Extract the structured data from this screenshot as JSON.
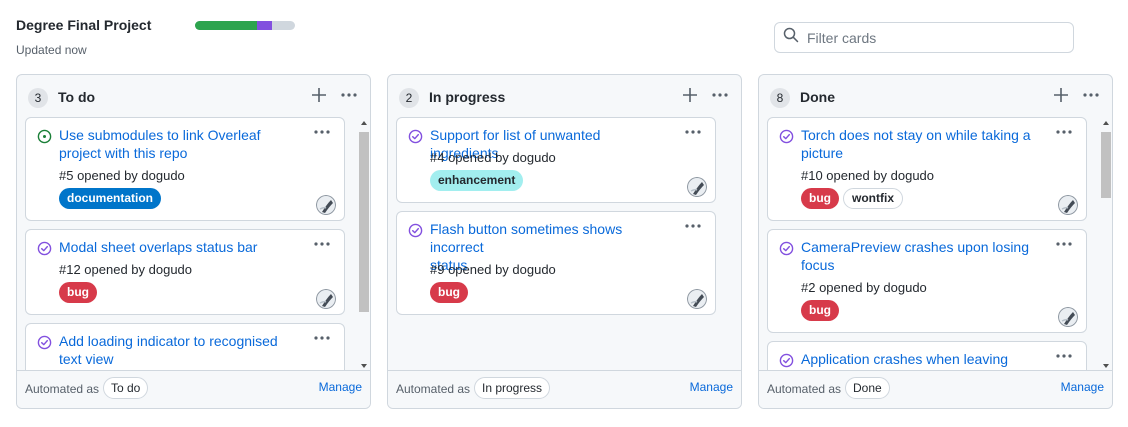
{
  "project": {
    "title": "Degree Final Project",
    "updated": "Updated now",
    "progress": {
      "done_percent": 62,
      "in_progress_percent": 15,
      "todo_percent": 23
    },
    "colors": {
      "done": "#2da44e",
      "in_progress": "#8250df",
      "todo": "#d0d7de"
    }
  },
  "filter": {
    "placeholder": "Filter cards",
    "value": "",
    "icon": "search-icon"
  },
  "columns": [
    {
      "count": "3",
      "title": "To do",
      "automated_prefix": "Automated as",
      "automated_value": "To do",
      "manage": "Manage",
      "cards": [
        {
          "title_line1": "Use submodules to link Overleaf",
          "title_line2": "project with this repo",
          "meta": "#5 opened by dogudo",
          "state": "open",
          "labels": [
            {
              "name": "documentation",
              "bg": "#0075ca",
              "fg": "#ffffff"
            }
          ]
        },
        {
          "title_line1": "Modal sheet overlaps status bar",
          "title_line2": "",
          "meta": "#12 opened by dogudo",
          "state": "closed",
          "labels": [
            {
              "name": "bug",
              "bg": "#d73a4a",
              "fg": "#ffffff"
            }
          ]
        },
        {
          "title_line1": "Add loading indicator to recognised",
          "title_line2": "text view",
          "meta": "",
          "state": "closed",
          "labels": []
        }
      ]
    },
    {
      "count": "2",
      "title": "In progress",
      "automated_prefix": "Automated as",
      "automated_value": "In progress",
      "manage": "Manage",
      "cards": [
        {
          "title_line1": "Support for list of unwanted ingredients",
          "title_line2": "",
          "meta": "#4 opened by dogudo",
          "state": "closed",
          "labels": [
            {
              "name": "enhancement",
              "bg": "#a2eeef",
              "fg": "#24292f"
            }
          ]
        },
        {
          "title_line1": "Flash button sometimes shows incorrect",
          "title_line2": "status",
          "meta": "#9 opened by dogudo",
          "state": "closed",
          "labels": [
            {
              "name": "bug",
              "bg": "#d73a4a",
              "fg": "#ffffff"
            }
          ]
        }
      ]
    },
    {
      "count": "8",
      "title": "Done",
      "automated_prefix": "Automated as",
      "automated_value": "Done",
      "manage": "Manage",
      "cards": [
        {
          "title_line1": "Torch does not stay on while taking a",
          "title_line2": "picture",
          "meta": "#10 opened by dogudo",
          "state": "closed",
          "labels": [
            {
              "name": "bug",
              "bg": "#d73a4a",
              "fg": "#ffffff"
            },
            {
              "name": "wontfix",
              "bg": "#ffffff",
              "fg": "#24292f"
            }
          ]
        },
        {
          "title_line1": "CameraPreview crashes upon losing",
          "title_line2": "focus",
          "meta": "#2 opened by dogudo",
          "state": "closed",
          "labels": [
            {
              "name": "bug",
              "bg": "#d73a4a",
              "fg": "#ffffff"
            }
          ]
        },
        {
          "title_line1": "Application crashes when leaving",
          "title_line2": "",
          "meta": "",
          "state": "closed",
          "labels": []
        }
      ]
    }
  ],
  "colors": {
    "open_icon": "#1a7f37",
    "closed_icon": "#8250df",
    "link": "#0969da"
  }
}
